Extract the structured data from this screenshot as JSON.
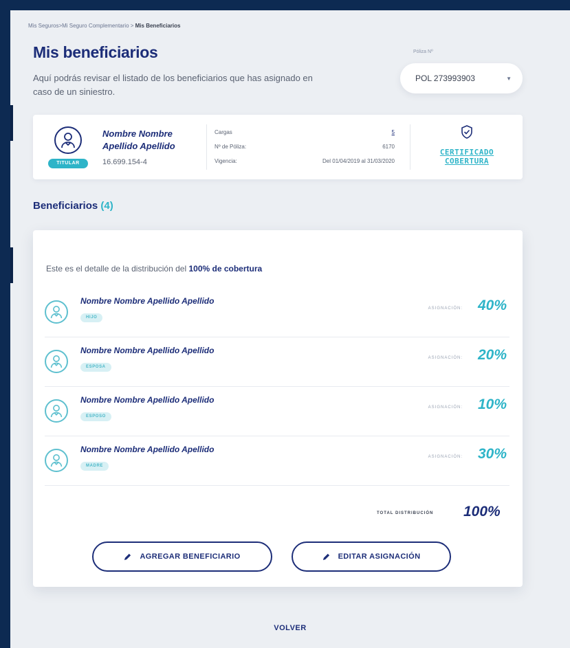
{
  "breadcrumb": {
    "item1": "Mis Seguros",
    "sep1": ">",
    "item2": "Mi Seguro Complementario",
    "sep2": " > ",
    "current": "Mis Beneficiarios"
  },
  "header": {
    "title": "Mis beneficiarios",
    "description": "Aquí podrás revisar el listado de los beneficiarios que has asignado en caso de un siniestro."
  },
  "poliza": {
    "label": "Póliza Nº",
    "selected": "POL 273993903"
  },
  "titular": {
    "name": "Nombre Nombre Apellido Apellido",
    "badge": "TITULAR",
    "rut": "16.699.154-4",
    "info": {
      "cargas_label": "Cargas",
      "cargas_value": "5",
      "poliza_label": "Nº de Póliza:",
      "poliza_value": "6170",
      "vigencia_label": "Vigencia:",
      "vigencia_value": "Del 01/04/2019 al 31/03/2020"
    },
    "certificate_line1": "CERTIFICADO",
    "certificate_line2": "COBERTURA"
  },
  "beneficiaries_section": {
    "title": "Beneficiarios",
    "count": "(4)",
    "intro_prefix": "Este es el detalle de la distribución del ",
    "intro_bold": "100% de cobertura",
    "assign_label": "ASIGNACIÓN:",
    "items": [
      {
        "name": "Nombre Nombre Apellido Apellido",
        "relation": "HIJO",
        "assignment": "40%"
      },
      {
        "name": "Nombre Nombre Apellido Apellido",
        "relation": "ESPOSA",
        "assignment": "20%"
      },
      {
        "name": "Nombre Nombre Apellido Apellido",
        "relation": "ESPOSO",
        "assignment": "10%"
      },
      {
        "name": "Nombre Nombre Apellido Apellido",
        "relation": "MADRE",
        "assignment": "30%"
      }
    ],
    "total_label": "TOTAL DISTRIBUCIÓN",
    "total_value": "100%"
  },
  "actions": {
    "add_label": "AGREGAR BENEFICIARIO",
    "edit_label": "EDITAR ASIGNACIÓN",
    "back_label": "VOLVER"
  },
  "icons": {
    "avatar": "user-icon",
    "shield": "shield-check-icon",
    "pencil": "pencil-icon",
    "caret": "caret-down-icon"
  },
  "colors": {
    "primary": "#1c2d78",
    "accent": "#2eb4c8",
    "background": "#eceff3",
    "frame": "#0d2a52"
  }
}
